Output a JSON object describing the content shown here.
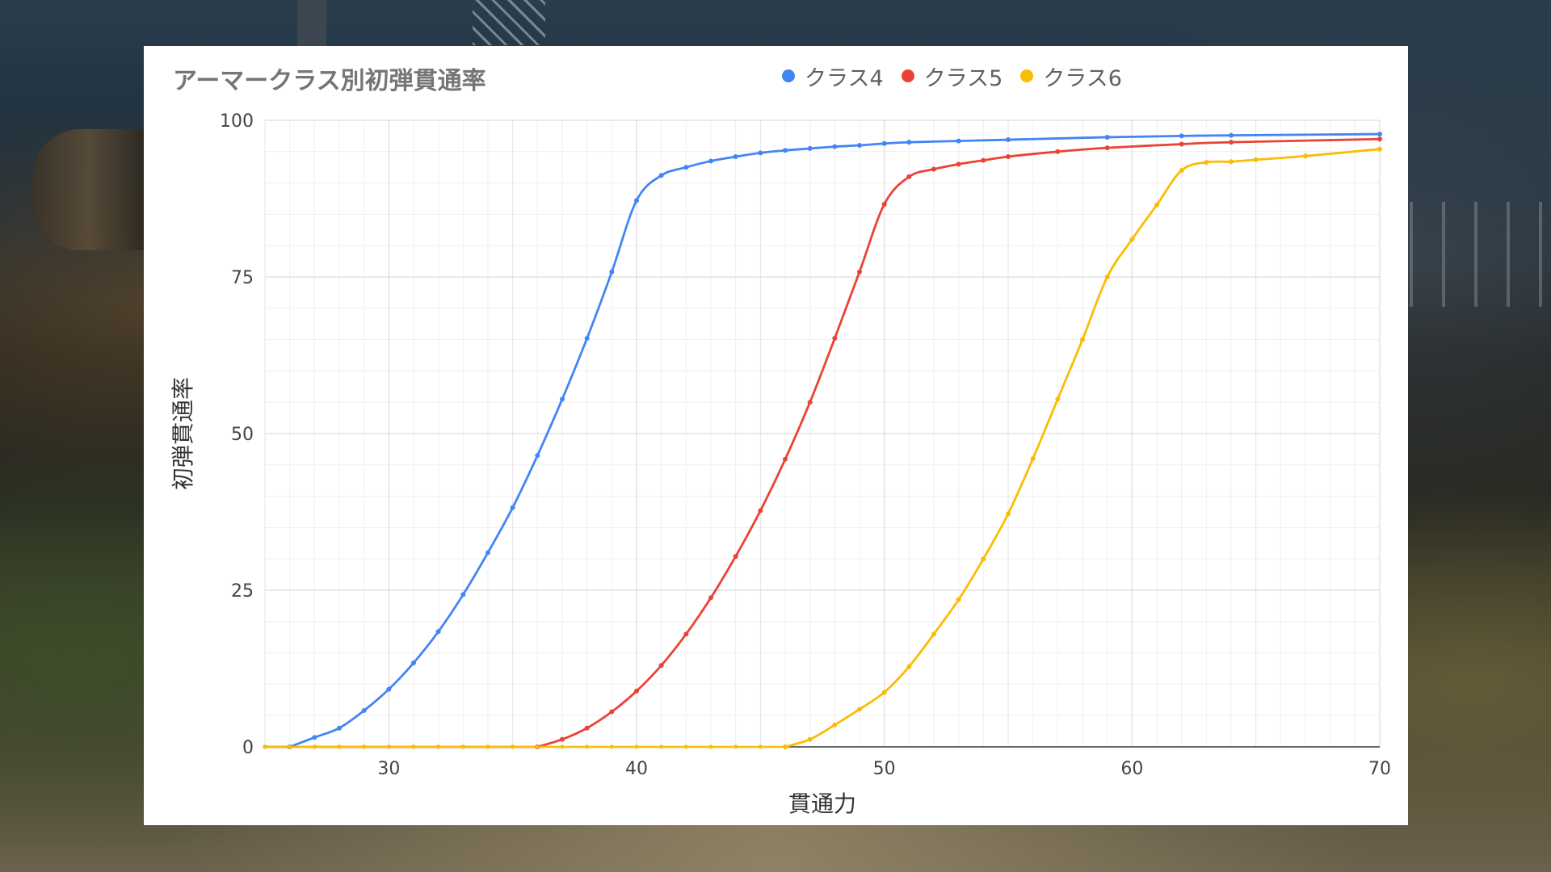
{
  "chart_data": {
    "type": "line",
    "title": "アーマークラス別初弾貫通率",
    "xlabel": "貫通力",
    "ylabel": "初弾貫通率",
    "xlim": [
      25,
      70
    ],
    "ylim": [
      0,
      100
    ],
    "x_ticks": [
      30,
      40,
      50,
      60,
      70
    ],
    "y_ticks": [
      0,
      25,
      50,
      75,
      100
    ],
    "grid": true,
    "minor_grid": true,
    "legend_position": "top",
    "series": [
      {
        "name": "クラス4",
        "color": "#4285f4",
        "points": [
          [
            26,
            0
          ],
          [
            27,
            1.5
          ],
          [
            28,
            3
          ],
          [
            29,
            5.8
          ],
          [
            30,
            9.2
          ],
          [
            31,
            13.4
          ],
          [
            32,
            18.4
          ],
          [
            33,
            24.3
          ],
          [
            34,
            31
          ],
          [
            35,
            38.2
          ],
          [
            36,
            46.5
          ],
          [
            37,
            55.5
          ],
          [
            38,
            65.2
          ],
          [
            39,
            75.8
          ],
          [
            40,
            87.2
          ],
          [
            41,
            91.2
          ],
          [
            42,
            92.5
          ],
          [
            43,
            93.5
          ],
          [
            44,
            94.2
          ],
          [
            45,
            94.8
          ],
          [
            46,
            95.2
          ],
          [
            47,
            95.5
          ],
          [
            48,
            95.8
          ],
          [
            49,
            96
          ],
          [
            50,
            96.3
          ],
          [
            51,
            96.5
          ],
          [
            53,
            96.7
          ],
          [
            55,
            96.9
          ],
          [
            59,
            97.3
          ],
          [
            62,
            97.5
          ],
          [
            64,
            97.6
          ],
          [
            70,
            97.8
          ]
        ]
      },
      {
        "name": "クラス5",
        "color": "#ea4335",
        "points": [
          [
            36,
            0
          ],
          [
            37,
            1.2
          ],
          [
            38,
            3
          ],
          [
            39,
            5.6
          ],
          [
            40,
            8.9
          ],
          [
            41,
            13
          ],
          [
            42,
            18
          ],
          [
            43,
            23.8
          ],
          [
            44,
            30.4
          ],
          [
            45,
            37.7
          ],
          [
            46,
            45.9
          ],
          [
            47,
            55
          ],
          [
            48,
            65.2
          ],
          [
            49,
            75.8
          ],
          [
            50,
            86.6
          ],
          [
            51,
            91
          ],
          [
            52,
            92.2
          ],
          [
            53,
            93
          ],
          [
            54,
            93.6
          ],
          [
            55,
            94.2
          ],
          [
            57,
            95
          ],
          [
            59,
            95.6
          ],
          [
            62,
            96.2
          ],
          [
            64,
            96.5
          ],
          [
            70,
            97
          ]
        ]
      },
      {
        "name": "クラス6",
        "color": "#fbbc04",
        "points": [
          [
            46,
            0
          ],
          [
            47,
            1.2
          ],
          [
            48,
            3.5
          ],
          [
            49,
            6
          ],
          [
            50,
            8.7
          ],
          [
            51,
            12.8
          ],
          [
            52,
            18
          ],
          [
            53,
            23.5
          ],
          [
            54,
            30
          ],
          [
            55,
            37.2
          ],
          [
            56,
            46
          ],
          [
            57,
            55.5
          ],
          [
            58,
            65
          ],
          [
            59,
            75
          ],
          [
            60,
            81
          ],
          [
            61,
            86.5
          ],
          [
            62,
            92
          ],
          [
            63,
            93.3
          ],
          [
            64,
            93.4
          ],
          [
            65,
            93.7
          ],
          [
            67,
            94.3
          ],
          [
            70,
            95.4
          ]
        ]
      }
    ]
  }
}
